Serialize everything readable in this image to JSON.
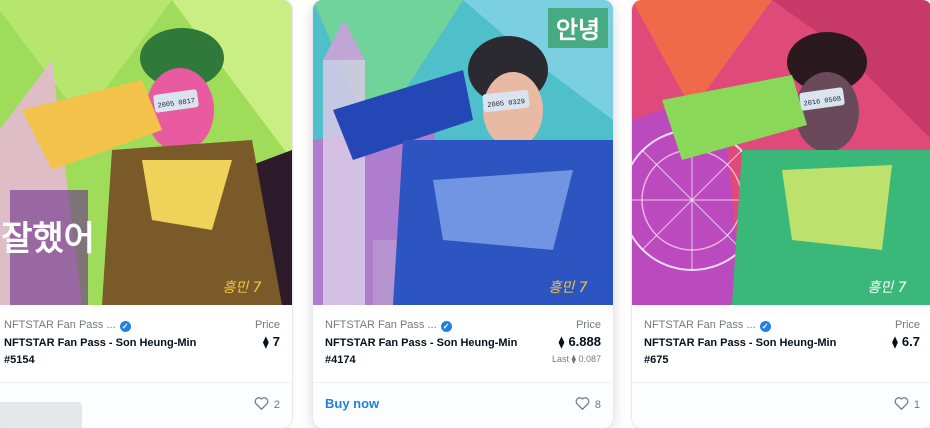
{
  "cards": [
    {
      "collection": "NFTSTAR Fan Pass ...",
      "name": "NFTSTAR Fan Pass - Son Heung-Min #5154",
      "price_label": "Price",
      "eth_symbol": "⧫",
      "price": "7",
      "last_price": "",
      "likes": "2",
      "verified_icon": "verified-check-icon",
      "like_icon": "heart-outline-icon",
      "palette": "#9fdc5a"
    },
    {
      "collection": "NFTSTAR Fan Pass ...",
      "name": "NFTSTAR Fan Pass - Son Heung-Min #4174",
      "price_label": "Price",
      "eth_symbol": "⧫",
      "price": "6.888",
      "last_label": "Last",
      "last_price": "0.087",
      "buy_label": "Buy now",
      "likes": "8",
      "verified_icon": "verified-check-icon",
      "like_icon": "heart-outline-icon",
      "palette": "#4fc0c9"
    },
    {
      "collection": "NFTSTAR Fan Pass ...",
      "name": "NFTSTAR Fan Pass - Son Heung-Min #675",
      "price_label": "Price",
      "eth_symbol": "⧫",
      "price": "6.7",
      "last_price": "",
      "likes": "1",
      "verified_icon": "verified-check-icon",
      "like_icon": "heart-outline-icon",
      "palette": "#e04a7a"
    }
  ],
  "artwork_text": {
    "card0_korean": "잘했어",
    "card0_tag": "2005 0817",
    "card1_korean": "안녕",
    "card1_tag": "2005 0329",
    "card2_tag": "2016 0508",
    "signature": "흥민 7"
  }
}
